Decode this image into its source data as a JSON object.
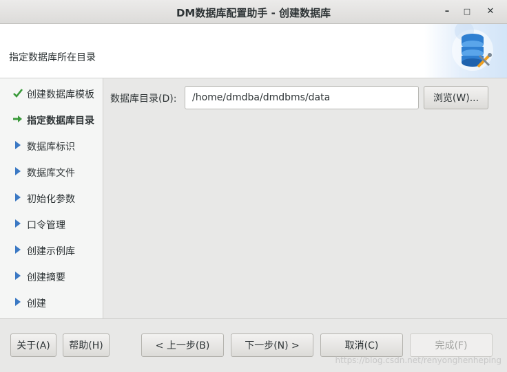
{
  "window": {
    "title": "DM数据库配置助手 - 创建数据库",
    "minimize": "–",
    "maximize": "□",
    "close": "✕"
  },
  "header": {
    "text": "指定数据库所在目录"
  },
  "steps": [
    {
      "label": "创建数据库模板",
      "state": "done"
    },
    {
      "label": "指定数据库目录",
      "state": "current"
    },
    {
      "label": "数据库标识",
      "state": "pending"
    },
    {
      "label": "数据库文件",
      "state": "pending"
    },
    {
      "label": "初始化参数",
      "state": "pending"
    },
    {
      "label": "口令管理",
      "state": "pending"
    },
    {
      "label": "创建示例库",
      "state": "pending"
    },
    {
      "label": "创建摘要",
      "state": "pending"
    },
    {
      "label": "创建",
      "state": "pending"
    }
  ],
  "form": {
    "dir_label": "数据库目录(D):",
    "dir_value": "/home/dmdba/dmdbms/data",
    "browse": "浏览(W)..."
  },
  "footer": {
    "about": "关于(A)",
    "help": "帮助(H)",
    "prev": "< 上一步(B)",
    "next": "下一步(N) >",
    "cancel": "取消(C)",
    "finish": "完成(F)"
  },
  "watermark": "https://blog.csdn.net/renyonghenheping",
  "colors": {
    "done_check": "#3a9a3a",
    "current_arrow": "#3a9a3a",
    "pending_arrow": "#3b79c4"
  }
}
